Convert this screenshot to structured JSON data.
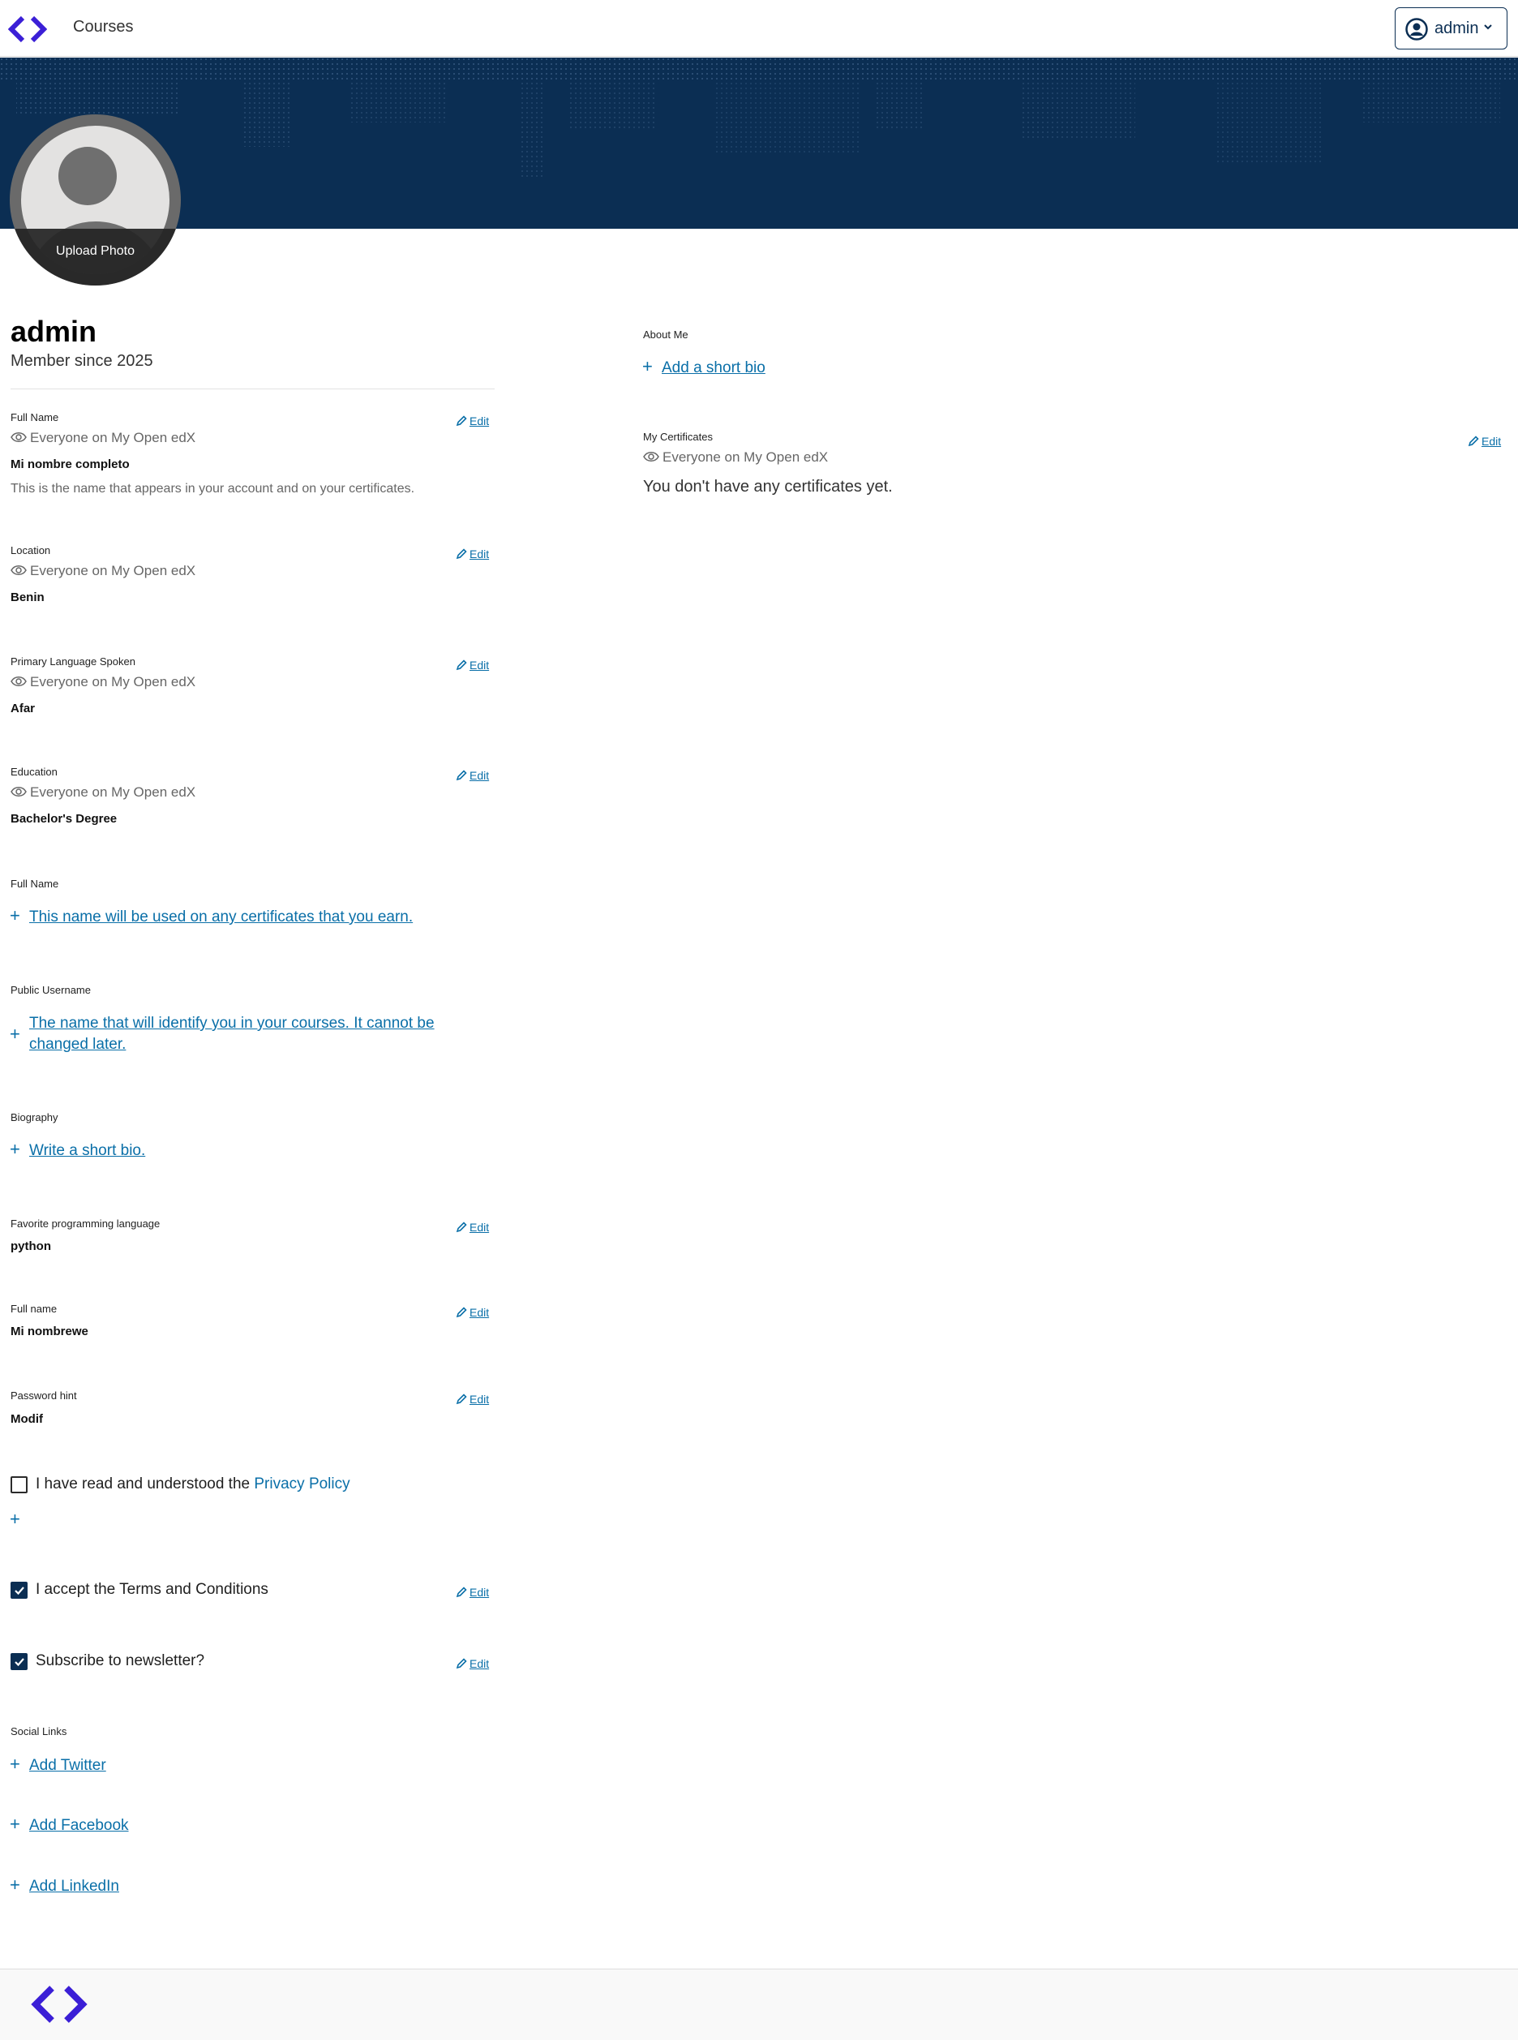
{
  "header": {
    "nav_courses": "Courses",
    "user_name": "admin"
  },
  "banner": {
    "upload_photo": "Upload Photo"
  },
  "profile": {
    "username": "admin",
    "member_since": "Member since 2025"
  },
  "visibility_text": "Everyone on My Open edX",
  "edit_label": "Edit",
  "fields": {
    "full_name": {
      "label": "Full Name",
      "visibility": "Everyone on My Open edX",
      "value": "Mi nombre completo",
      "help": "This is the name that appears in your account and on your certificates."
    },
    "location": {
      "label": "Location",
      "visibility": "Everyone on My Open edX",
      "value": "Benin"
    },
    "language": {
      "label": "Primary Language Spoken",
      "visibility": "Everyone on My Open edX",
      "value": "Afar"
    },
    "education": {
      "label": "Education",
      "visibility": "Everyone on My Open edX",
      "value": "Bachelor's Degree"
    },
    "full_name_2": {
      "label": "Full Name",
      "add_link": "This name will be used on any certificates that you earn."
    },
    "public_username": {
      "label": "Public Username",
      "add_link_line1": "The name that will identify you in your courses. It cannot be",
      "add_link_line2": "changed later."
    },
    "biography": {
      "label": "Biography",
      "add_link": "Write a short bio."
    },
    "fav_language": {
      "label": "Favorite programming language",
      "value": "python"
    },
    "full_name_3": {
      "label": "Full name",
      "value": "Mi nombrewe"
    },
    "password_hint": {
      "label": "Password hint",
      "value": "Modif"
    }
  },
  "checkboxes": {
    "privacy": {
      "label": "I have read and understood the ",
      "link": "Privacy Policy",
      "checked": false
    },
    "terms": {
      "label": "I accept the Terms and Conditions",
      "checked": true
    },
    "newsletter": {
      "label": "Subscribe to newsletter?",
      "checked": true
    }
  },
  "social": {
    "label": "Social Links",
    "twitter": "Add Twitter",
    "facebook": "Add Facebook",
    "linkedin": "Add LinkedIn"
  },
  "right": {
    "about_label": "About Me",
    "about_link": "Add a short bio",
    "certs_label": "My Certificates",
    "certs_visibility": "Everyone on My Open edX",
    "certs_empty": "You don't have any certificates yet."
  },
  "colors": {
    "brand_purple": "#3b1fd6",
    "banner_navy": "#0b2e53",
    "link_blue": "#0a6fa8"
  }
}
